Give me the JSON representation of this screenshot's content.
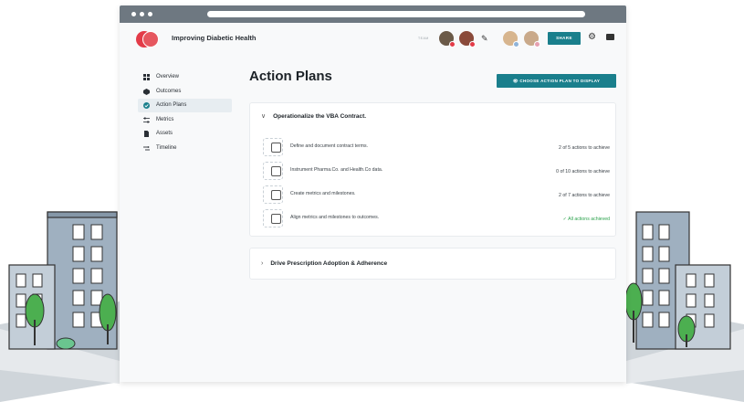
{
  "app": {
    "project_title": "Improving Diabetic Health",
    "team_label": "TEAM",
    "share_label": "SHARE"
  },
  "sidebar": {
    "items": [
      {
        "label": "Overview",
        "icon": "grid-icon"
      },
      {
        "label": "Outcomes",
        "icon": "hexagon-icon"
      },
      {
        "label": "Action Plans",
        "icon": "check-circle-icon",
        "active": true
      },
      {
        "label": "Metrics",
        "icon": "sliders-icon"
      },
      {
        "label": "Assets",
        "icon": "document-icon"
      },
      {
        "label": "Timeline",
        "icon": "timeline-icon"
      }
    ]
  },
  "main": {
    "title": "Action Plans",
    "choose_button": "CHOOSE ACTION PLAN TO DISPLAY",
    "plans": [
      {
        "title": "Operationalize the VBA Contract.",
        "expanded": true,
        "actions": [
          {
            "label": "Define and document contract terms.",
            "status": "2 of 5 actions to achieve"
          },
          {
            "label": "Instrument Pharma.Co. and Health.Co data.",
            "status": "0 of 10 actions to achieve"
          },
          {
            "label": "Create metrics and milestones.",
            "status": "2 of 7 actions to achieve"
          },
          {
            "label": "Align metrics and milestones to outcomes.",
            "status": "✓ All actions achieved"
          }
        ]
      },
      {
        "title": "Drive Prescription Adoption & Adherence",
        "expanded": false
      }
    ]
  },
  "colors": {
    "accent": "#1a7f8c",
    "brand_red": "#e33b48",
    "success": "#2ba24c"
  }
}
